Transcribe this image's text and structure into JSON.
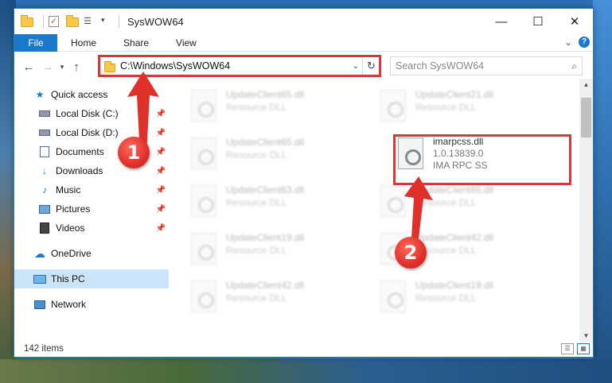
{
  "window": {
    "title": "SysWOW64"
  },
  "ribbon": {
    "tabs": [
      "File",
      "Home",
      "Share",
      "View"
    ]
  },
  "address": {
    "path": "C:\\Windows\\SysWOW64"
  },
  "search": {
    "placeholder": "Search SysWOW64"
  },
  "sidebar": {
    "items": [
      {
        "label": "Quick access",
        "icon": "star-icon"
      },
      {
        "label": "Local Disk (C:)",
        "icon": "drive-icon",
        "pinned": true
      },
      {
        "label": "Local Disk (D:)",
        "icon": "drive-icon",
        "pinned": true
      },
      {
        "label": "Documents",
        "icon": "documents-icon",
        "pinned": true
      },
      {
        "label": "Downloads",
        "icon": "download-icon",
        "pinned": true
      },
      {
        "label": "Music",
        "icon": "music-icon",
        "pinned": true
      },
      {
        "label": "Pictures",
        "icon": "pictures-icon",
        "pinned": true
      },
      {
        "label": "Videos",
        "icon": "videos-icon",
        "pinned": true
      },
      {
        "label": "OneDrive",
        "icon": "cloud-icon"
      },
      {
        "label": "This PC",
        "icon": "computer-icon",
        "selected": true
      },
      {
        "label": "Network",
        "icon": "network-icon"
      }
    ]
  },
  "files": [
    {
      "name": "UpdateClient65.dll",
      "type": "Resource DLL"
    },
    {
      "name": "UpdateClient21.dll",
      "type": "Resource DLL"
    },
    {
      "name": "UpdateClient65.dll",
      "type": "Resource DLL"
    },
    {
      "name": "imarpcss.dll",
      "version": "1.0.13839.0",
      "type": "IMA RPC SS"
    },
    {
      "name": "UpdateClient63.dll",
      "type": "Resource DLL"
    },
    {
      "name": "UpdateClient65.dll",
      "type": "Resource DLL"
    },
    {
      "name": "UpdateClient19.dll",
      "type": "Resource DLL"
    },
    {
      "name": "UpdateClient42.dll",
      "type": "Resource DLL"
    },
    {
      "name": "UpdateClient42.dll",
      "type": "Resource DLL"
    },
    {
      "name": "UpdateClient19.dll",
      "type": "Resource DLL"
    }
  ],
  "status": {
    "count": "142 items"
  },
  "callouts": [
    "1",
    "2"
  ],
  "colors": {
    "accent": "#1979ca",
    "highlight": "#d9383a",
    "selected_bg": "#cce4f7"
  }
}
